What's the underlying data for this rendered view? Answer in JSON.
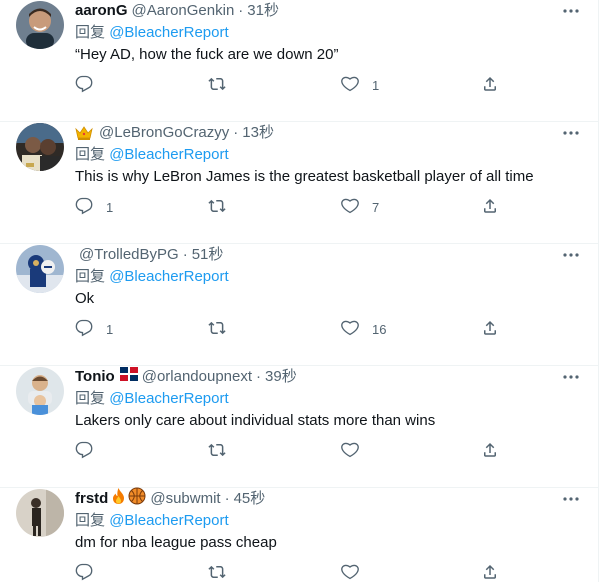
{
  "reply_prefix": "回复",
  "tweets": [
    {
      "name": "aaronG",
      "name_emoji": [],
      "handle": "@AaronGenkin",
      "time": "31秒",
      "reply_to": "@BleacherReport",
      "text": "“Hey AD, how the fuck are we down 20”",
      "replies": "",
      "retweets": "",
      "likes": "1"
    },
    {
      "name": "",
      "name_emoji": [
        "crown"
      ],
      "handle": "@LeBronGoCrazyy",
      "time": "13秒",
      "reply_to": "@BleacherReport",
      "text": "This is why LeBron James is the greatest basketball player of all time",
      "replies": "1",
      "retweets": "",
      "likes": "7"
    },
    {
      "name": "",
      "name_emoji": [],
      "handle": "@TrolledByPG",
      "time": "51秒",
      "reply_to": "@BleacherReport",
      "text": "Ok",
      "replies": "1",
      "retweets": "",
      "likes": "16"
    },
    {
      "name": "Tonio",
      "name_emoji": [
        "dominican-republic-flag"
      ],
      "handle": "@orlandoupnext",
      "time": "39秒",
      "reply_to": "@BleacherReport",
      "text": "Lakers only care about individual stats more than wins",
      "replies": "",
      "retweets": "",
      "likes": ""
    },
    {
      "name": "frstd",
      "name_emoji": [
        "fire",
        "basketball"
      ],
      "handle": "@subwmit",
      "time": "45秒",
      "reply_to": "@BleacherReport",
      "text": "dm for nba league pass cheap",
      "replies": "",
      "retweets": "",
      "likes": ""
    }
  ],
  "colors": {
    "text": "#0f1419",
    "secondary": "#536471",
    "link": "#1d9bf0",
    "divider": "#eff3f4"
  },
  "icons": [
    "more-icon",
    "reply-icon",
    "retweet-icon",
    "like-icon",
    "share-icon"
  ]
}
